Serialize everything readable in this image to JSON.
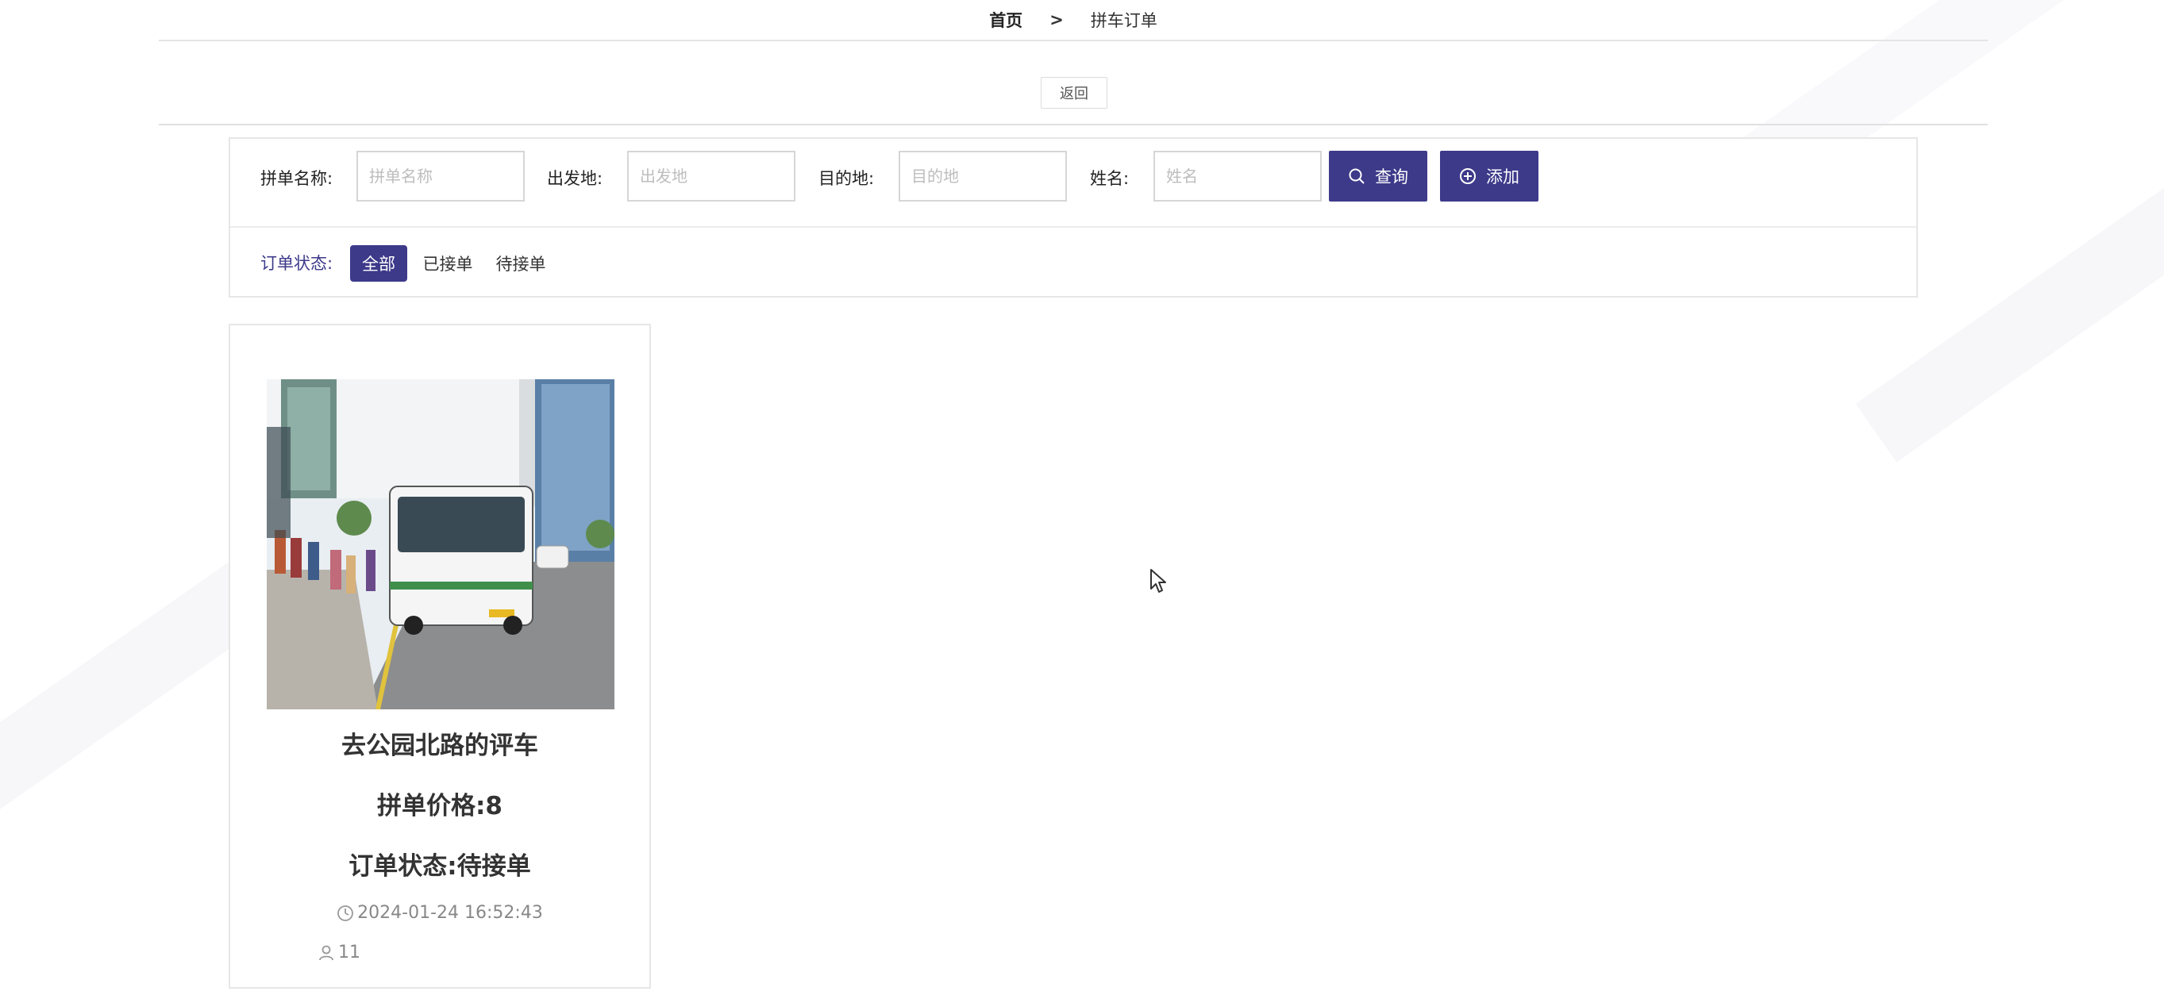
{
  "breadcrumb": {
    "home": "首页",
    "separator": ">",
    "current": "拼车订单"
  },
  "back_button": "返回",
  "filters": {
    "name_label": "拼单名称:",
    "name_placeholder": "拼单名称",
    "from_label": "出发地:",
    "from_placeholder": "出发地",
    "to_label": "目的地:",
    "to_placeholder": "目的地",
    "person_label": "姓名:",
    "person_placeholder": "姓名",
    "search_button": "查询",
    "add_button": "添加"
  },
  "status_filter": {
    "label": "订单状态:",
    "options": [
      {
        "label": "全部",
        "active": true
      },
      {
        "label": "已接单",
        "active": false
      },
      {
        "label": "待接单",
        "active": false
      }
    ]
  },
  "cards": [
    {
      "image_icon": "bus-photo",
      "title": "去公园北路的评车",
      "price": "拼单价格:8",
      "status": "订单状态:待接单",
      "time": "2024-01-24 16:52:43",
      "views": "11"
    }
  ],
  "colors": {
    "primary": "#3d3a8a",
    "border": "#e6e6e6",
    "muted_text": "#888888"
  }
}
